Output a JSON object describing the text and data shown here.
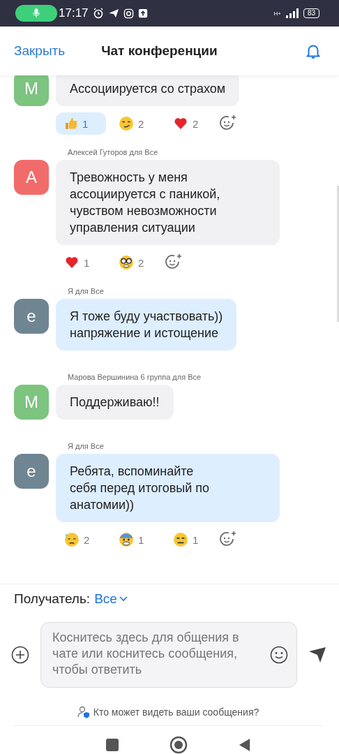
{
  "status_bar": {
    "time": "17:17",
    "network": "H+",
    "battery": "83"
  },
  "header": {
    "close": "Закрыть",
    "title": "Чат конференции"
  },
  "messages": [
    {
      "avatar": "М",
      "color": "#7cc47f",
      "mine": false,
      "text": "Ассоциируется со страхом",
      "reactions": [
        {
          "kind": "thumbs",
          "count": "1",
          "selected": true
        },
        {
          "kind": "smirk",
          "count": "2",
          "selected": false
        },
        {
          "kind": "heart",
          "count": "2",
          "selected": false
        }
      ]
    },
    {
      "sender": "Алексей Гуторов для Все",
      "avatar": "А",
      "color": "#f26b6b",
      "mine": false,
      "text": "Тревожность у меня ассоциируется с паникой, чувством невозможности управления ситуации",
      "reactions": [
        {
          "kind": "heart",
          "count": "1",
          "selected": false
        },
        {
          "kind": "nerd",
          "count": "2",
          "selected": false
        }
      ]
    },
    {
      "sender": "Я для Все",
      "avatar": "е",
      "color": "#6f8592",
      "mine": true,
      "text": "Я тоже буду участвовать))\nнапряжение и истощение"
    },
    {
      "sender": "Марова Вершинина 6 группа для Все",
      "avatar": "М",
      "color": "#7cc47f",
      "mine": false,
      "text": "Поддерживаю!!"
    },
    {
      "sender": "Я для Все",
      "avatar": "е",
      "color": "#6f8592",
      "mine": true,
      "text": "Ребята, вспоминайте\nсебя перед итоговый по анатомии))",
      "reactions": [
        {
          "kind": "sweat",
          "count": "2",
          "selected": false
        },
        {
          "kind": "fear",
          "count": "1",
          "selected": false
        },
        {
          "kind": "neutral",
          "count": "1",
          "selected": false
        }
      ]
    }
  ],
  "recipient": {
    "label": "Получатель:",
    "value": "Все"
  },
  "composer": {
    "placeholder": "Коснитесь здесь для общения в чате или коснитесь сообщения, чтобы ответить"
  },
  "privacy_link": "Кто может видеть ваши сообщения?"
}
